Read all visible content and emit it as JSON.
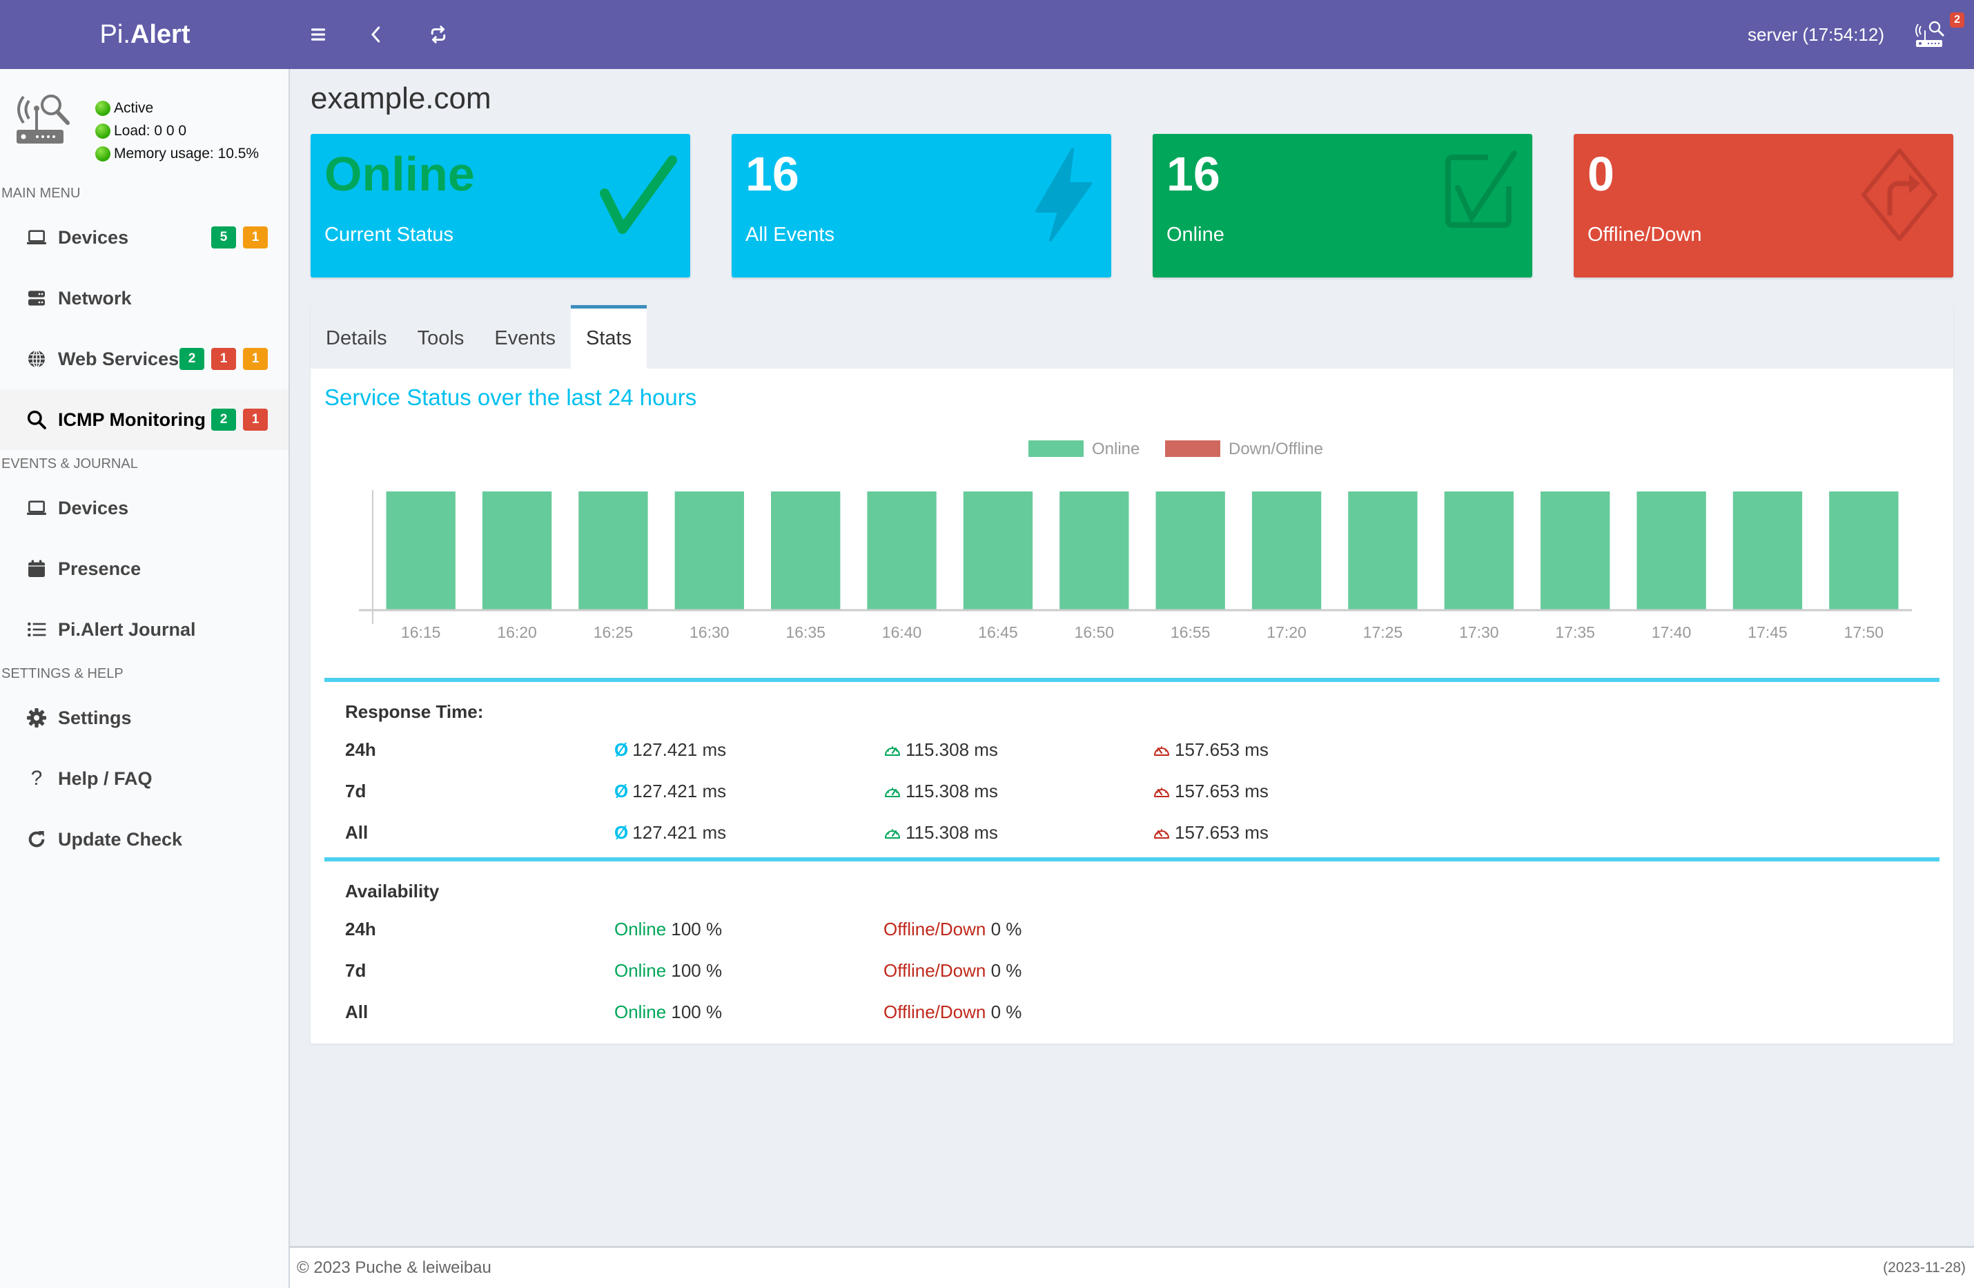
{
  "header": {
    "logo_thin": "Pi.",
    "logo_bold": "Alert",
    "server_time": "server (17:54:12)",
    "notification_count": "2",
    "icons": [
      "menu-icon",
      "back-icon",
      "refresh-icon",
      "router-search-icon"
    ]
  },
  "sidebar": {
    "status": {
      "active": "Active",
      "load": "Load:  0  0  0",
      "memory": "Memory usage:  10.5%"
    },
    "sections": {
      "main": "MAIN MENU",
      "events": "EVENTS & JOURNAL",
      "settings": "SETTINGS & HELP"
    },
    "main_items": [
      {
        "label": "Devices",
        "icon": "laptop-icon",
        "badges": [
          {
            "value": "5",
            "color": "green"
          },
          {
            "value": "1",
            "color": "orange"
          }
        ]
      },
      {
        "label": "Network",
        "icon": "server-icon",
        "badges": []
      },
      {
        "label": "Web Services",
        "icon": "globe-icon",
        "badges": [
          {
            "value": "2",
            "color": "green"
          },
          {
            "value": "1",
            "color": "red"
          },
          {
            "value": "1",
            "color": "orange"
          }
        ]
      },
      {
        "label": "ICMP Monitoring",
        "icon": "search-icon",
        "active": true,
        "badges": [
          {
            "value": "2",
            "color": "green"
          },
          {
            "value": "1",
            "color": "red"
          }
        ]
      }
    ],
    "events_items": [
      {
        "label": "Devices",
        "icon": "laptop-icon"
      },
      {
        "label": "Presence",
        "icon": "calendar-icon"
      },
      {
        "label": "Pi.Alert Journal",
        "icon": "list-icon"
      }
    ],
    "settings_items": [
      {
        "label": "Settings",
        "icon": "gear-icon"
      },
      {
        "label": "Help / FAQ",
        "icon": "question-icon"
      },
      {
        "label": "Update Check",
        "icon": "refresh-icon"
      }
    ]
  },
  "page": {
    "title": "example.com"
  },
  "info_boxes": [
    {
      "value": "Online",
      "label": "Current Status",
      "color": "#00c0ef",
      "icon": "check-icon"
    },
    {
      "value": "16",
      "label": "All Events",
      "color": "#00c0ef",
      "icon": "bolt-icon"
    },
    {
      "value": "16",
      "label": "Online",
      "color": "#00a65a",
      "icon": "check-square-icon"
    },
    {
      "value": "0",
      "label": "Offline/Down",
      "color": "#dd4b39",
      "icon": "diamond-turn-right-icon"
    }
  ],
  "tabs": [
    {
      "label": "Details",
      "active": false
    },
    {
      "label": "Tools",
      "active": false
    },
    {
      "label": "Events",
      "active": false
    },
    {
      "label": "Stats",
      "active": true
    }
  ],
  "stats": {
    "chart_title": "Service Status over the last 24 hours",
    "response_time": {
      "heading": "Response Time:",
      "avg_symbol": "Ø",
      "rows": [
        {
          "period": "24h",
          "avg": "127.421 ms",
          "min": "115.308 ms",
          "max": "157.653 ms"
        },
        {
          "period": "7d",
          "avg": "127.421 ms",
          "min": "115.308 ms",
          "max": "157.653 ms"
        },
        {
          "period": "All",
          "avg": "127.421 ms",
          "min": "115.308 ms",
          "max": "157.653 ms"
        }
      ]
    },
    "availability": {
      "heading": "Availability",
      "online_label": "Online",
      "offline_label": "Offline/Down",
      "rows": [
        {
          "period": "24h",
          "online": "100 %",
          "offline": "0 %"
        },
        {
          "period": "7d",
          "online": "100 %",
          "offline": "0 %"
        },
        {
          "period": "All",
          "online": "100 %",
          "offline": "0 %"
        }
      ]
    }
  },
  "chart_data": {
    "type": "bar",
    "title": "",
    "stacked": true,
    "categories": [
      "16:15",
      "16:20",
      "16:25",
      "16:30",
      "16:35",
      "16:40",
      "16:45",
      "16:50",
      "16:55",
      "17:20",
      "17:25",
      "17:30",
      "17:35",
      "17:40",
      "17:45",
      "17:50"
    ],
    "series": [
      {
        "name": "Online",
        "color": "#66cb9b",
        "values": [
          1,
          1,
          1,
          1,
          1,
          1,
          1,
          1,
          1,
          1,
          1,
          1,
          1,
          1,
          1,
          1
        ]
      },
      {
        "name": "Down/Offline",
        "color": "#d0685e",
        "values": [
          0,
          0,
          0,
          0,
          0,
          0,
          0,
          0,
          0,
          0,
          0,
          0,
          0,
          0,
          0,
          0
        ]
      }
    ],
    "xlabel": "",
    "ylabel": "",
    "ylim": [
      0,
      1
    ],
    "grid": false,
    "legend": "top-center"
  },
  "footer": {
    "copyright": "© 2023 Puche & leiweibau",
    "version_date": "(2023-11-28)"
  }
}
